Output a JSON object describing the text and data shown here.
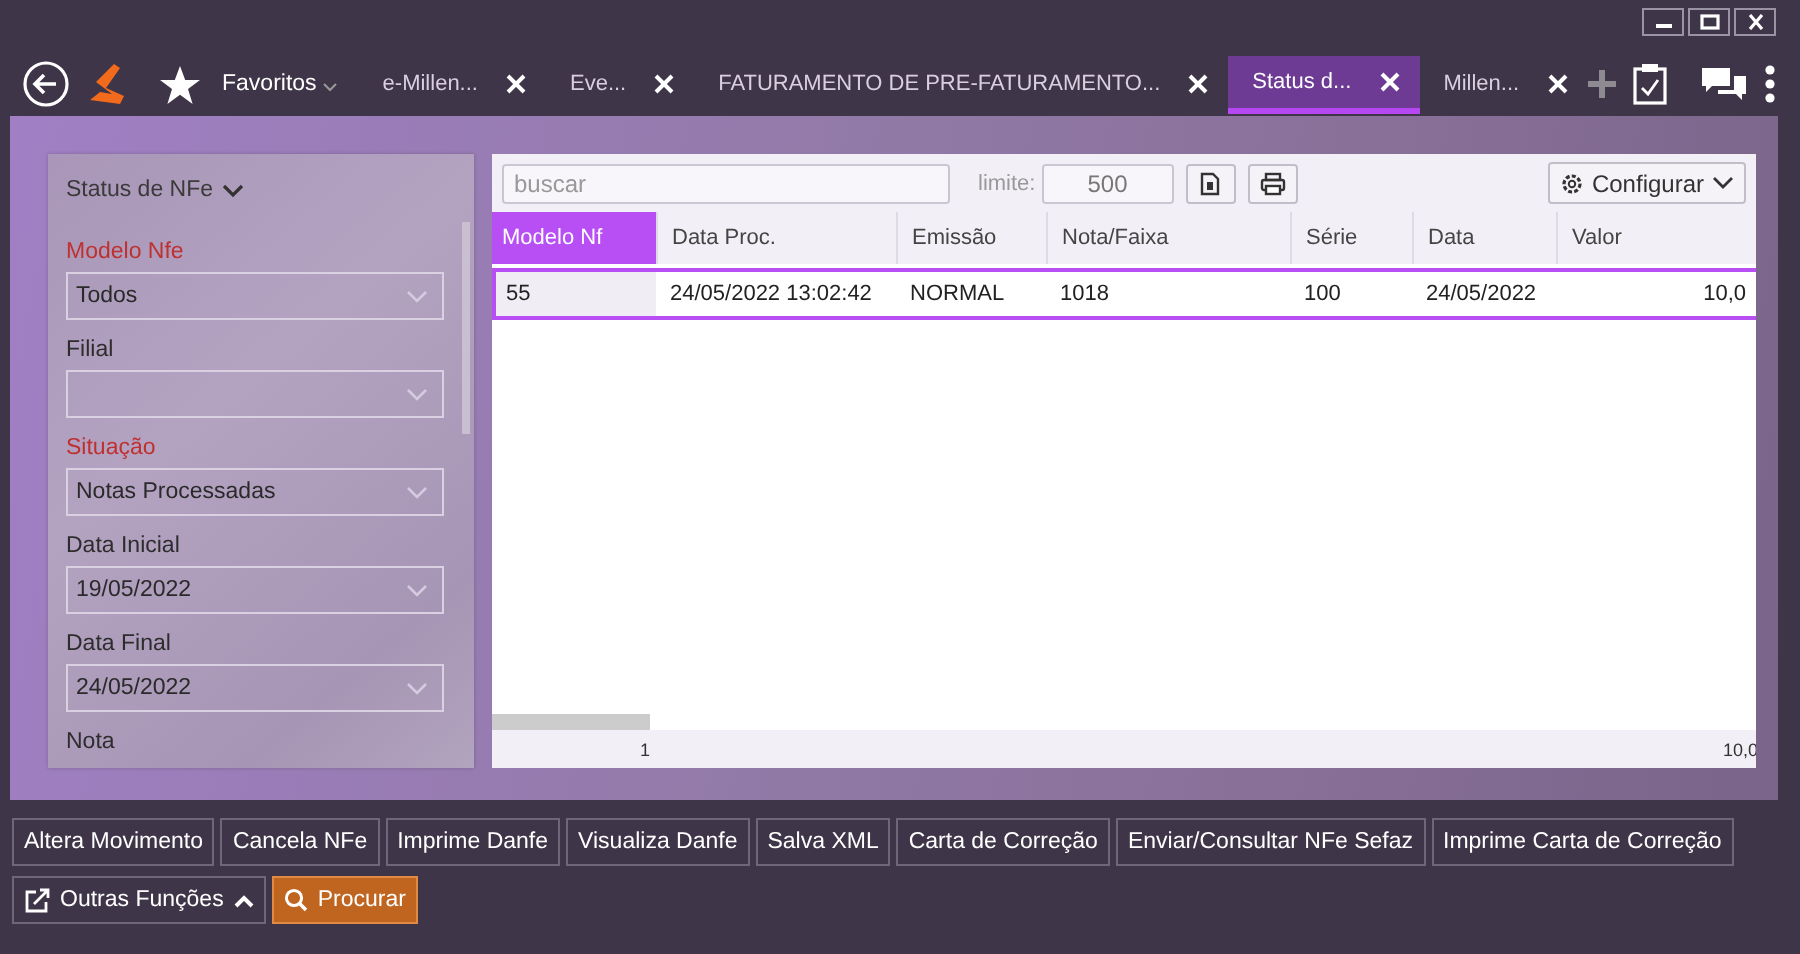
{
  "toolbar": {
    "favorites": "Favoritos"
  },
  "tabs": [
    {
      "label": "e-Millen...",
      "selected": false
    },
    {
      "label": "Eve...",
      "selected": false
    },
    {
      "label": "FATURAMENTO DE PRE-FATURAMENTO...",
      "selected": false
    },
    {
      "label": "Status d...",
      "selected": true
    },
    {
      "label": "Millen...",
      "selected": false
    }
  ],
  "filter_panel": {
    "title": "Status de NFe",
    "fields": [
      {
        "label": "Modelo Nfe",
        "required": true,
        "kind": "select",
        "value": "Todos"
      },
      {
        "label": "Filial",
        "required": false,
        "kind": "select"
      },
      {
        "label": "Situação",
        "required": true,
        "kind": "select",
        "value": "Notas Processadas"
      },
      {
        "label": "Data Inicial",
        "required": false,
        "kind": "select",
        "value": "19/05/2022"
      },
      {
        "label": "Data Final",
        "required": false,
        "kind": "select",
        "value": "24/05/2022"
      },
      {
        "label": "Nota",
        "required": false,
        "kind": "input"
      }
    ]
  },
  "grid_toolbar": {
    "search": {
      "placeholder": "buscar"
    },
    "limit_label": "limite:",
    "limit": "500",
    "configure": "Configurar"
  },
  "table": {
    "columns": [
      {
        "label": "Modelo Nf",
        "selected": true
      },
      {
        "label": "Data Proc.",
        "selected": false
      },
      {
        "label": "Emissão",
        "selected": false
      },
      {
        "label": "Nota/Faixa",
        "selected": false
      },
      {
        "label": "Série",
        "selected": false
      },
      {
        "label": "Data",
        "selected": false
      },
      {
        "label": "Valor",
        "selected": false
      }
    ],
    "rows": [
      {
        "selected": true,
        "cells": [
          "55",
          "24/05/2022 13:02:42",
          "NORMAL",
          "1018",
          "100",
          "24/05/2022",
          "10,0"
        ]
      }
    ],
    "footer": {
      "count": "1",
      "total": "10,0"
    }
  },
  "actions": [
    "Altera Movimento",
    "Cancela NFe",
    "Imprime Danfe",
    "Visualiza Danfe",
    "Salva XML",
    "Carta de Correção",
    "Enviar/Consultar NFe Sefaz",
    "Imprime Carta de Correção"
  ],
  "bottom_buttons": [
    {
      "label": "Outras Funções",
      "kind": "menu"
    },
    {
      "label": "Procurar",
      "kind": "primary"
    }
  ]
}
